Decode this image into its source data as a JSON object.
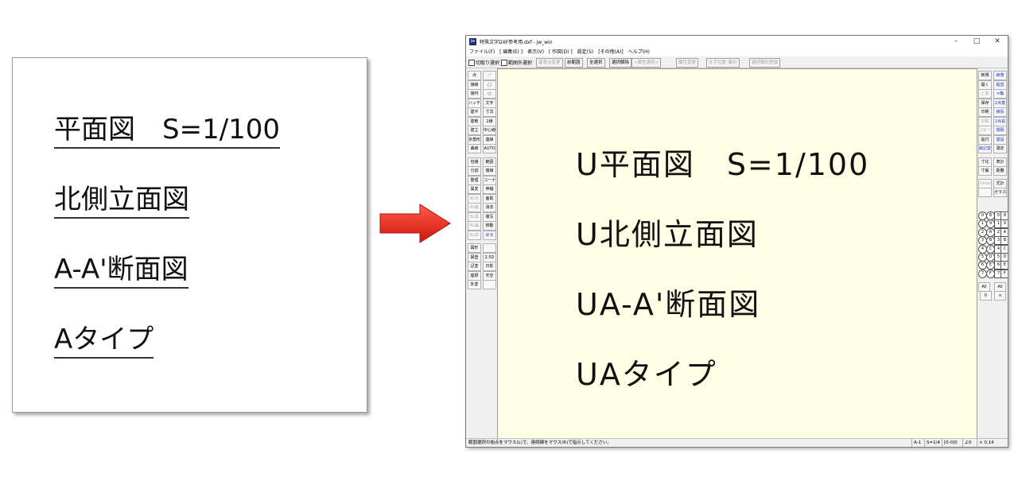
{
  "reference": {
    "lines": [
      "平面図　S=1/100",
      "北側立面図",
      "A-A'断面図",
      "Aタイプ"
    ]
  },
  "window": {
    "title": "特殊文字DXF参考用.dxf - jw_win",
    "icon_text": "jw",
    "min": "–",
    "max": "□",
    "close": "✕",
    "menu": [
      "ファイル(F)",
      "[ 編集(E) ]",
      "表示(V)",
      "[ 作図(D) ]",
      "設定(S)",
      "[その他(A)]",
      "ヘルプ(H)"
    ],
    "toolbar": {
      "check1": "切取り選択",
      "check2": "範囲外選択",
      "buttons": [
        "基準点変更",
        "前範囲",
        "全選択",
        "選択解除",
        "<属性選択>",
        "属性変更",
        "文字位置･集計",
        "選択図形登録"
      ]
    },
    "left_tools": [
      [
        "点",
        "／"
      ],
      [
        "接線",
        "□"
      ],
      [
        "接円",
        "○"
      ],
      [
        "ハッチ",
        "文字"
      ],
      [
        "建平",
        "寸法"
      ],
      [
        "建断",
        "2線"
      ],
      [
        "建立",
        "中心線"
      ],
      [
        "多角形",
        "連線"
      ],
      [
        "曲線",
        "AUTO"
      ],
      [
        "包絡",
        "範囲"
      ],
      [
        "分割",
        "複線"
      ],
      [
        "整理",
        "コーナー"
      ],
      [
        "属変",
        "伸縮"
      ],
      [
        "BL化",
        "面取"
      ],
      [
        "BL解",
        "消去"
      ],
      [
        "BL属",
        "複写"
      ],
      [
        "BL編",
        "移動"
      ],
      [
        "BL終",
        "戻る"
      ],
      [
        "図形",
        ""
      ],
      [
        "図登",
        "2.5D"
      ],
      [
        "記変",
        "日影"
      ],
      [
        "座標",
        "天空"
      ],
      [
        "外変",
        ""
      ]
    ],
    "right_tools": [
      [
        "新規",
        "線角"
      ],
      [
        "開く",
        "鉛直"
      ],
      [
        "上書",
        "×軸"
      ],
      [
        "保存",
        "2点角"
      ],
      [
        "印刷",
        "線長"
      ],
      [
        "切取",
        "2点長"
      ],
      [
        "コピー",
        "間隔"
      ],
      [
        "貼付",
        "基設"
      ],
      [
        "線記変",
        "測定"
      ],
      [
        "寸化",
        "表計"
      ],
      [
        "寸解",
        "距離"
      ],
      [
        "Undo",
        "式計"
      ],
      [
        "",
        "ガラス"
      ]
    ],
    "layer_numbers": [
      "0",
      "1",
      "2",
      "3",
      "4",
      "5",
      "6",
      "7",
      "8",
      "9",
      "A",
      "B",
      "C",
      "D",
      "E",
      "F"
    ],
    "all_labels": [
      "All",
      "All",
      "0",
      "×"
    ],
    "canvas_lines": [
      "U平面図　S=1/100",
      "U北側立面図",
      "UA-A'断面図",
      "UAタイプ"
    ],
    "status": {
      "message": "範囲選択の始点をマウス(L)で、連続線をマウス(R)で指示してください。",
      "paper": "A-1",
      "scale": "S=1/4",
      "layer": "[0-0]0",
      "angle": "∠0",
      "zoom": "× 0.14"
    }
  },
  "colors": {
    "canvas_bg": "#ffffe6",
    "arrow": "#e8241a",
    "accent_blue": "#1a33cc"
  }
}
